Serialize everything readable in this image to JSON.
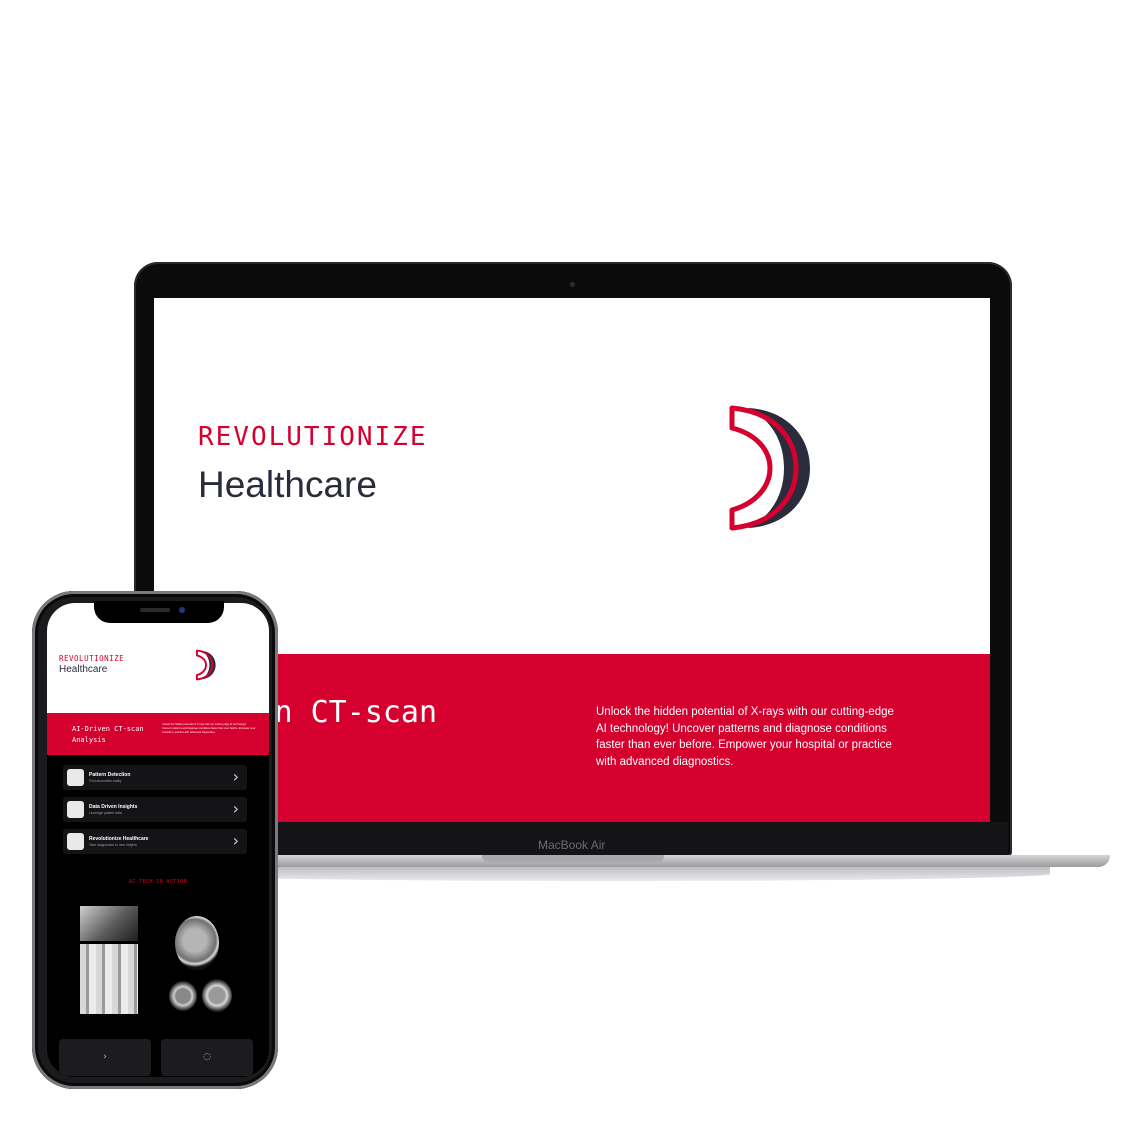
{
  "desktop": {
    "hero": {
      "kicker": "REVOLUTIONIZE",
      "title": "Healthcare"
    },
    "banner": {
      "heading": "AI-Driven CT-scan\nAnalysis",
      "body": "Unlock the hidden potential of X-rays with our cutting-edge AI technology! Uncover patterns and diagnose conditions faster than ever before. Empower your hospital or practice with advanced diagnostics."
    },
    "device_label": "MacBook Air"
  },
  "mobile": {
    "hero": {
      "kicker": "REVOLUTIONIZE",
      "title": "Healthcare"
    },
    "banner": {
      "heading": "AI-Driven CT-scan\nAnalysis",
      "body": "Unlock the hidden potential of X-rays with our cutting-edge AI technology! Uncover patterns and diagnose conditions faster than ever before. Empower your hospital or practice with advanced diagnostics."
    },
    "features": [
      {
        "title": "Pattern Detection",
        "subtitle": "Find anomalies easily",
        "icon": "scan-icon"
      },
      {
        "title": "Data Driven Insights",
        "subtitle": "Leverage patient data",
        "icon": "chart-icon"
      },
      {
        "title": "Revolutionize Healthcare",
        "subtitle": "Take diagnostics to new heights",
        "icon": "pulse-icon"
      }
    ],
    "section_title": "AI TECH IN ACTION",
    "bottom_nav": [
      {
        "icon": "logo-icon",
        "glyph": "›"
      },
      {
        "icon": "refresh-icon",
        "glyph": "◌"
      }
    ]
  },
  "colors": {
    "accent": "#d6002f",
    "navy": "#2a2c3c",
    "background": "#ffffff"
  }
}
